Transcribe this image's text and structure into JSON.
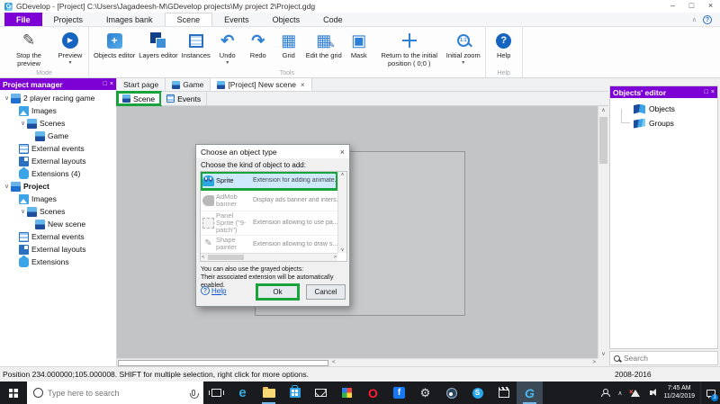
{
  "icons": {
    "minimize": "–",
    "maximize": "□",
    "close": "×",
    "dropdown_arrow": "▾",
    "tree_caret": "∨",
    "chevron_up": "∧",
    "chevron_down": "∨",
    "chevron_left": "<",
    "chevron_right": ">",
    "play": "▶",
    "pencil": "✎",
    "undo": "↶",
    "redo": "↷",
    "grid": "▦",
    "mask": "▣",
    "question_mark": "?",
    "plus": "+",
    "zoom_ratio": "1:1",
    "annotation_green": "#18a33c",
    "accent_purple": "#7d00d4",
    "selection_blue": "#cfe9fc"
  },
  "titlebar": {
    "title": "GDevelop - [Project] C:\\Users\\Jagadeesh-M\\GDevelop projects\\My project 2\\Project.gdg"
  },
  "menubar": {
    "tabs": [
      "File",
      "Projects",
      "Images bank",
      "Scene",
      "Events",
      "Objects",
      "Code"
    ],
    "active_tab": "Scene"
  },
  "ribbon": {
    "groups": [
      {
        "label": "Mode",
        "buttons": [
          {
            "label": "Stop the preview"
          },
          {
            "label": "Preview"
          }
        ]
      },
      {
        "label": "Tools",
        "buttons": [
          {
            "label": "Objects editor"
          },
          {
            "label": "Layers editor"
          },
          {
            "label": "Instances"
          },
          {
            "label": "Undo"
          },
          {
            "label": "Redo"
          },
          {
            "label": "Grid"
          },
          {
            "label": "Edit the grid"
          },
          {
            "label": "Mask"
          },
          {
            "label": "Return to the initial position ( 0;0 )"
          },
          {
            "label": "Initial zoom"
          }
        ]
      },
      {
        "label": "Help",
        "buttons": [
          {
            "label": "Help"
          }
        ]
      }
    ]
  },
  "project_manager": {
    "title": "Project manager",
    "items": [
      {
        "label": "2 player racing game"
      },
      {
        "label": "Images"
      },
      {
        "label": "Scenes"
      },
      {
        "label": "Game"
      },
      {
        "label": "External events"
      },
      {
        "label": "External layouts"
      },
      {
        "label": "Extensions (4)"
      },
      {
        "label": "Project"
      },
      {
        "label": "Images"
      },
      {
        "label": "Scenes"
      },
      {
        "label": "New scene"
      },
      {
        "label": "External events"
      },
      {
        "label": "External layouts"
      },
      {
        "label": "Extensions"
      }
    ]
  },
  "document_tabs": [
    {
      "label": "Start page"
    },
    {
      "label": "Game"
    },
    {
      "label": "[Project] New scene"
    }
  ],
  "scene_tabs": [
    {
      "label": "Scene"
    },
    {
      "label": "Events"
    }
  ],
  "dialog": {
    "title": "Choose an object type",
    "prompt": "Choose the kind of object to add:",
    "rows": [
      {
        "name": "Sprite",
        "desc": "Extension for adding animate.."
      },
      {
        "name": "AdMob banner",
        "desc": "Display ads banner and inters..."
      },
      {
        "name": "Panel Sprite (\"9-patch\")",
        "desc": "Extension allowing to use pa..."
      },
      {
        "name": "Shape painter",
        "desc": "Extension allowing to draw s..."
      }
    ],
    "note_line1": "You can also use the grayed objects:",
    "note_line2": "Their associated extension will be automatically enabled.",
    "help_label": "Help",
    "ok_label": "Ok",
    "cancel_label": "Cancel"
  },
  "objects_editor": {
    "title": "Objects' editor",
    "items": [
      {
        "label": "Objects"
      },
      {
        "label": "Groups"
      }
    ],
    "search_placeholder": "Search",
    "version_text": "2008-2016"
  },
  "status_bar": {
    "text": "Position 234.000000;105.000008. SHIFT for multiple selection, right click for more options."
  },
  "taskbar": {
    "search_placeholder": "Type here to search",
    "clock_time": "7:45 AM",
    "clock_date": "11/24/2019",
    "notification_count": "3"
  }
}
